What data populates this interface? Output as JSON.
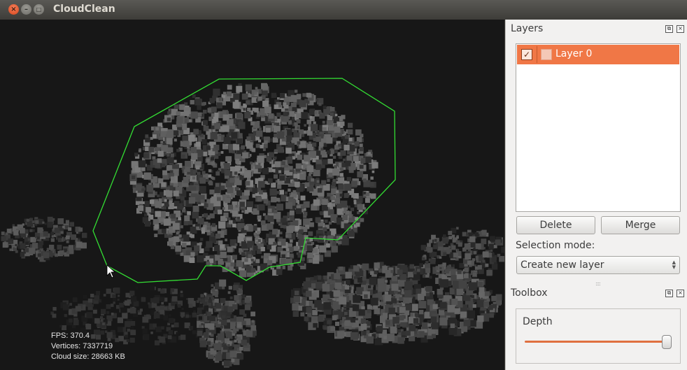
{
  "window": {
    "title": "CloudClean"
  },
  "viewport": {
    "stats": {
      "fps": "FPS:  370.4",
      "vertices": "Vertices: 7337719",
      "cloud_size": "Cloud size: 28663 KB"
    },
    "selection_color": "#33dd33"
  },
  "layers_dock": {
    "title": "Layers",
    "layers": [
      {
        "name": "Layer 0",
        "visible": true,
        "color": "#f4c8b6"
      }
    ],
    "delete_label": "Delete",
    "merge_label": "Merge",
    "selection_mode_label": "Selection mode:",
    "selection_mode_value": "Create new layer"
  },
  "toolbox_dock": {
    "title": "Toolbox",
    "depth_label": "Depth",
    "depth_value": 0.98
  },
  "accent_color": "#f07746"
}
